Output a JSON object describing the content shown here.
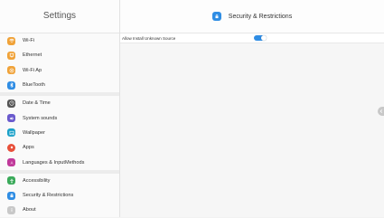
{
  "sidebar": {
    "title": "Settings",
    "groups": [
      {
        "items": [
          {
            "label": "Wi-Fi",
            "color": "#f0a238",
            "icon": "wifi-icon"
          },
          {
            "label": "Ethernet",
            "color": "#f0a238",
            "icon": "ethernet-icon"
          },
          {
            "label": "Wi-Fi Ap",
            "color": "#f0a238",
            "icon": "hotspot-icon"
          },
          {
            "label": "BlueTooth",
            "color": "#2f8de4",
            "icon": "bluetooth-icon"
          }
        ]
      },
      {
        "items": [
          {
            "label": "Date & Time",
            "color": "#555555",
            "icon": "clock-icon"
          },
          {
            "label": "System sounds",
            "color": "#6a5acd",
            "icon": "speaker-icon"
          },
          {
            "label": "Wallpaper",
            "color": "#1aa0c8",
            "icon": "wallpaper-icon"
          },
          {
            "label": "Apps",
            "color": "#e8503a",
            "icon": "apps-icon"
          },
          {
            "label": "Languages & InputMethods",
            "color": "#c0399a",
            "icon": "language-icon"
          }
        ]
      },
      {
        "items": [
          {
            "label": "Accessibility",
            "color": "#3aaa5a",
            "icon": "accessibility-icon"
          },
          {
            "label": "Security & Restrictions",
            "color": "#2f8de4",
            "icon": "lock-icon"
          },
          {
            "label": "About",
            "color": "#c8c8c8",
            "icon": "info-icon"
          }
        ]
      }
    ]
  },
  "header": {
    "title": "Security & Restrictions",
    "icon": "lock-icon",
    "color": "#2f8de4"
  },
  "settings": [
    {
      "label": "Allow Install Unknown Source",
      "enabled": true
    }
  ]
}
